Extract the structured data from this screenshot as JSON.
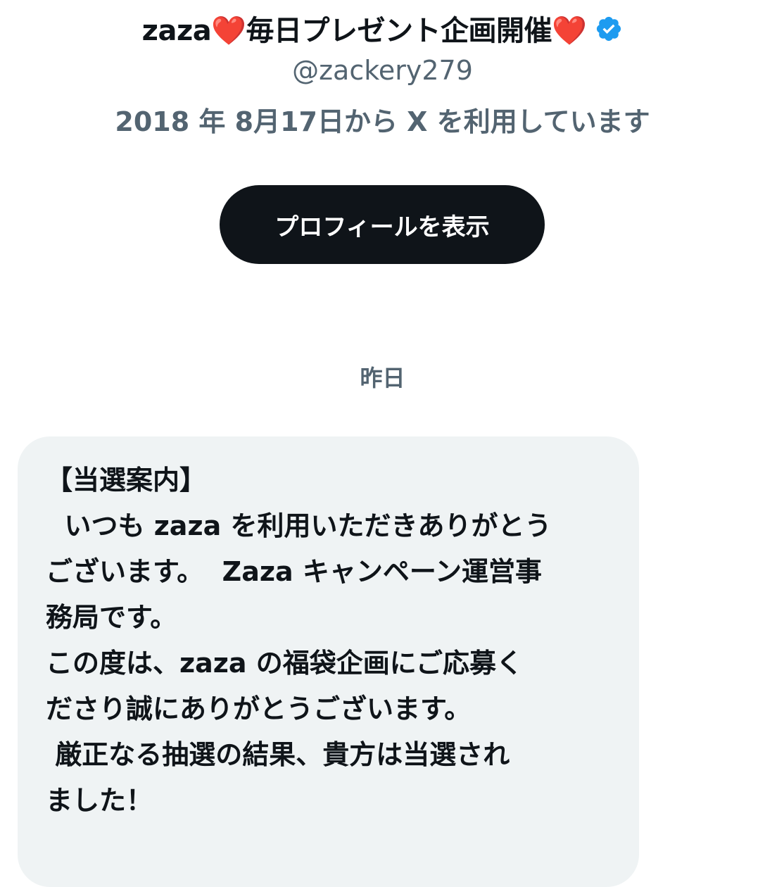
{
  "profile": {
    "display_name": "zaza❤️毎日プレゼント企画開催❤️",
    "verified_icon": "verified-badge-icon",
    "handle": "@zackery279",
    "joined": "2018 年 8月17日から X を利用しています"
  },
  "actions": {
    "view_profile_label": "プロフィールを表示"
  },
  "conversation": {
    "date_separator": "昨日",
    "message_lines": [
      "【当選案内】",
      "  いつも zaza を利用いただきありがとう",
      "ございます。  Zaza キャンペーン運営事",
      "務局です。",
      "この度は、zaza の福袋企画にご応募く",
      "ださり誠にありがとうございます。",
      " 厳正なる抽選の結果、貴方は当選され",
      "ました！"
    ]
  },
  "colors": {
    "text_primary": "#0f1419",
    "text_secondary": "#536471",
    "button_bg": "#0f1419",
    "bubble_bg": "#eff3f4",
    "verified_blue": "#1d9bf0"
  }
}
